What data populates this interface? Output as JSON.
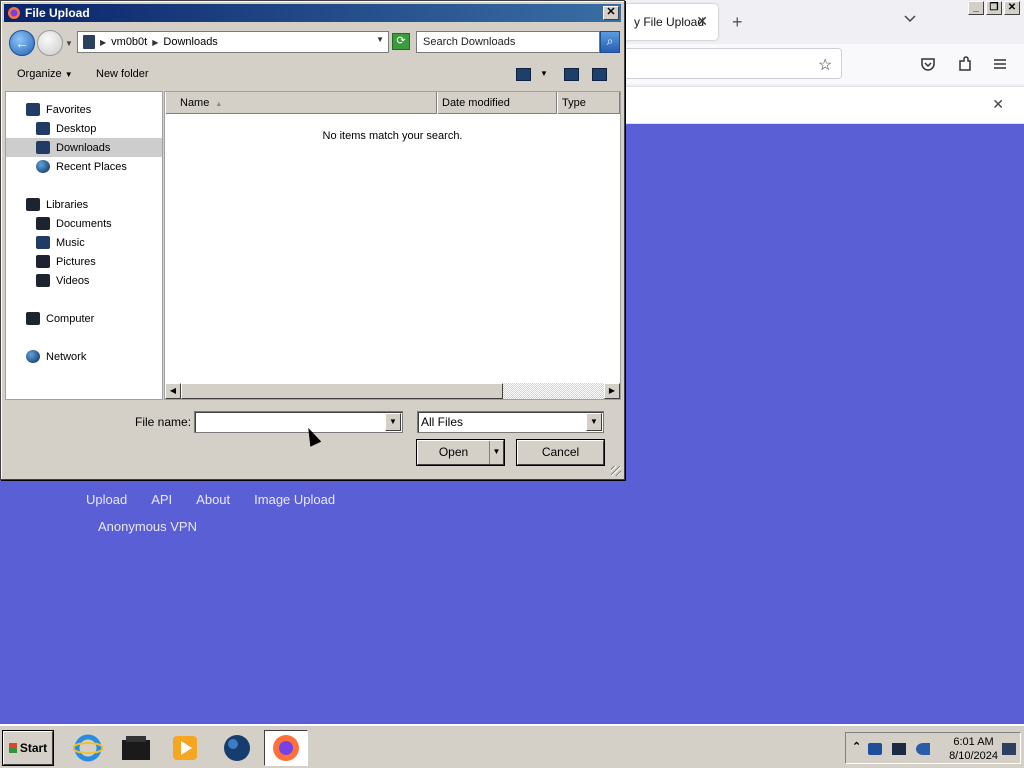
{
  "browser": {
    "tab_title": "y File Upload",
    "tab_close": "✕",
    "new_tab": "+",
    "notif_close": "✕",
    "star_icon": "☆"
  },
  "page": {
    "links": [
      "Upload",
      "API",
      "About",
      "Image Upload"
    ],
    "link2": "Anonymous VPN",
    "background": "#5a5fd6"
  },
  "dialog": {
    "title": "File Upload",
    "close": "✕",
    "breadcrumb": [
      "vm0b0t",
      "Downloads"
    ],
    "search_placeholder": "Search Downloads",
    "organize": "Organize",
    "new_folder": "New folder",
    "nav": {
      "favorites": "Favorites",
      "desktop": "Desktop",
      "downloads": "Downloads",
      "recent": "Recent Places",
      "libraries": "Libraries",
      "documents": "Documents",
      "music": "Music",
      "pictures": "Pictures",
      "videos": "Videos",
      "computer": "Computer",
      "network": "Network"
    },
    "columns": [
      "Name",
      "Date modified",
      "Type"
    ],
    "empty_message": "No items match your search.",
    "file_name_label": "File name:",
    "file_name_value": "",
    "file_type": "All Files",
    "open": "Open",
    "cancel": "Cancel"
  },
  "taskbar": {
    "start": "Start",
    "time": "6:01 AM",
    "date": "8/10/2024"
  }
}
